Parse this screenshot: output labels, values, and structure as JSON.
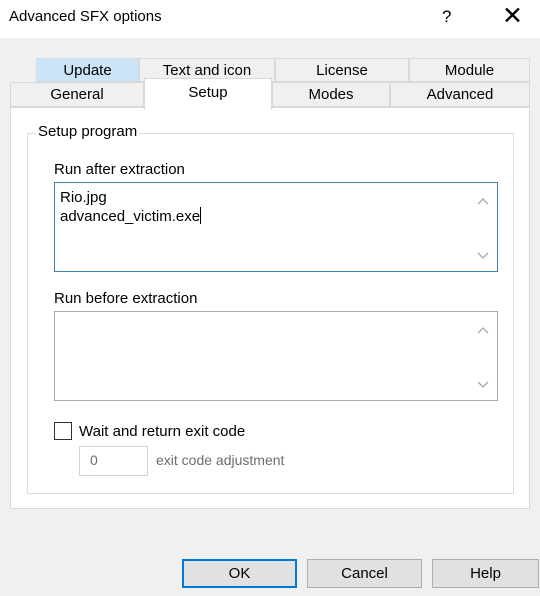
{
  "window": {
    "title": "Advanced SFX options",
    "help_glyph": "?",
    "close_glyph": "✕"
  },
  "tabs": {
    "row1": [
      "Update",
      "Text and icon",
      "License",
      "Module"
    ],
    "row2": [
      "General",
      "Setup",
      "Modes",
      "Advanced"
    ],
    "active": "Setup",
    "hovered": "Update"
  },
  "setup_group": {
    "legend": "Setup program",
    "run_after_label": "Run after extraction",
    "run_after_lines": [
      "Rio.jpg",
      "advanced_victim.exe"
    ],
    "run_before_label": "Run before extraction",
    "run_before_lines": [],
    "wait_checkbox_label": "Wait and return exit code",
    "wait_checked": false,
    "exit_code_value": "0",
    "exit_code_label": "exit code adjustment"
  },
  "buttons": {
    "ok": "OK",
    "cancel": "Cancel",
    "help": "Help"
  }
}
